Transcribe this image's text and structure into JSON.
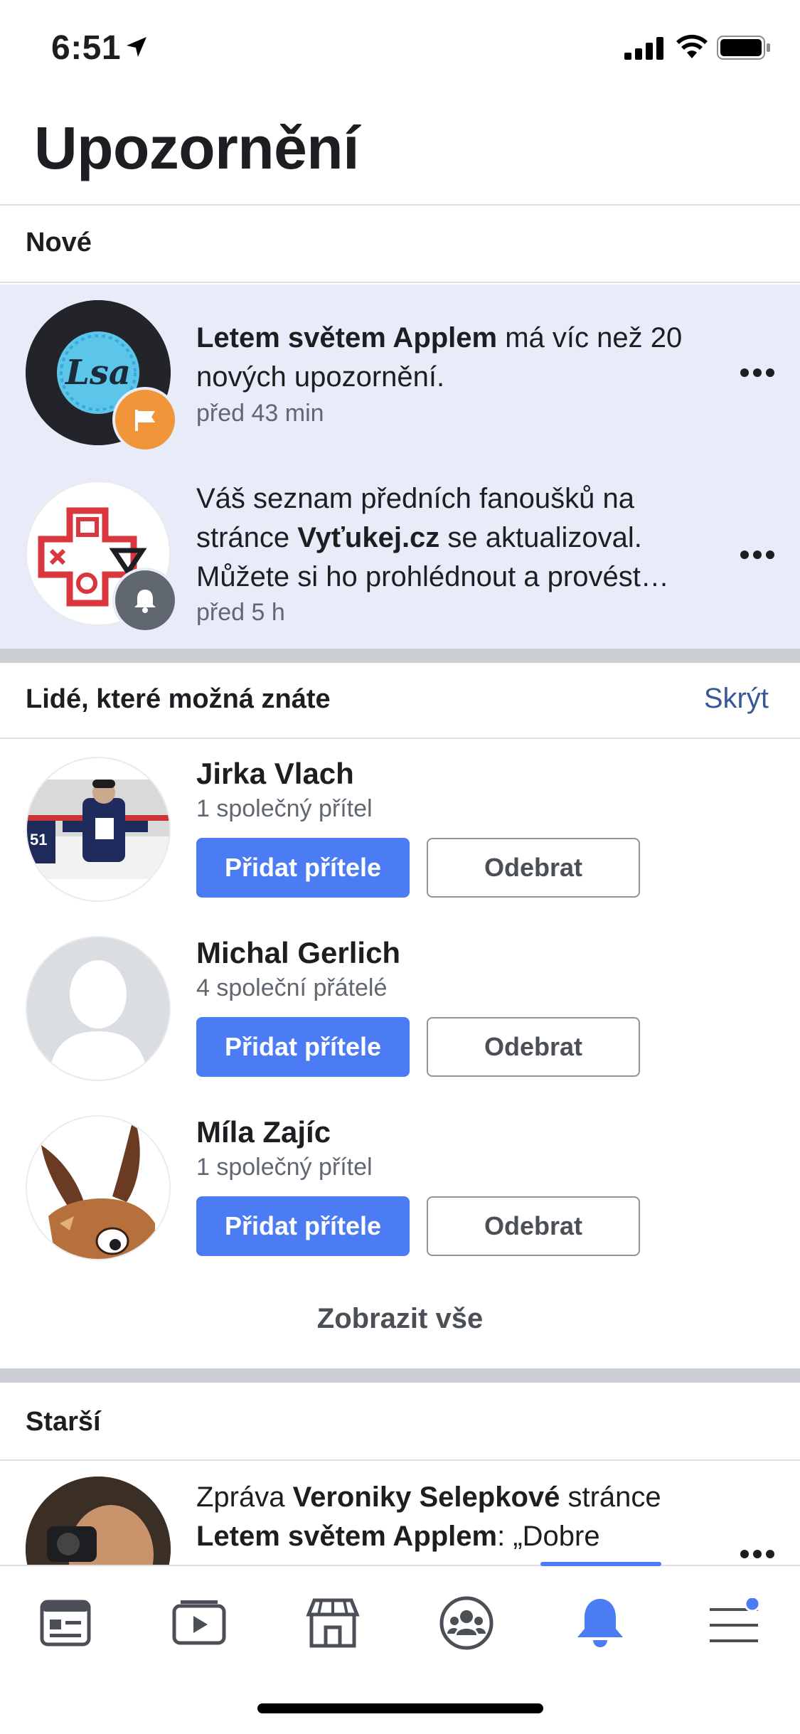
{
  "status": {
    "time": "6:51"
  },
  "page": {
    "title": "Upozornění"
  },
  "new_section": {
    "header": "Nové",
    "items": [
      {
        "bold1": "Letem světem Applem",
        "text1": " má víc než 20 nových upozornění.",
        "time": "před 43 min",
        "badge_icon": "flag-icon",
        "badge_color": "#f0953a"
      },
      {
        "text1": "Váš seznam předních fanoušků na stránce ",
        "bold1": "Vyťukej.cz",
        "text2": " se aktualizoval. Můžete si ho prohlédnout a provést…",
        "time": "před 5 h",
        "badge_icon": "bell-icon",
        "badge_color": "#606770"
      }
    ]
  },
  "pymk": {
    "header": "Lidé, které možná znáte",
    "hide_label": "Skrýt",
    "add_label": "Přidat přítele",
    "remove_label": "Odebrat",
    "people": [
      {
        "name": "Jirka Vlach",
        "mutual": "1 společný přítel"
      },
      {
        "name": "Michal Gerlich",
        "mutual": "4 společní přátelé"
      },
      {
        "name": "Míla Zajíc",
        "mutual": "1 společný přítel"
      }
    ],
    "show_all": "Zobrazit vše"
  },
  "older_section": {
    "header": "Starší",
    "items": [
      {
        "text1": "Zpráva ",
        "bold1": "Veroniky Selepkové",
        "text2": " stránce ",
        "bold2": "Letem světem Applem",
        "text3": ": „Dobre"
      }
    ]
  },
  "tabs": [
    {
      "name": "news-feed-icon"
    },
    {
      "name": "watch-icon"
    },
    {
      "name": "marketplace-icon"
    },
    {
      "name": "groups-icon"
    },
    {
      "name": "notifications-icon",
      "active": true
    },
    {
      "name": "menu-icon"
    }
  ],
  "colors": {
    "accent": "#4b7cf3",
    "link": "#385898",
    "new_bg": "#e7ecf8"
  }
}
